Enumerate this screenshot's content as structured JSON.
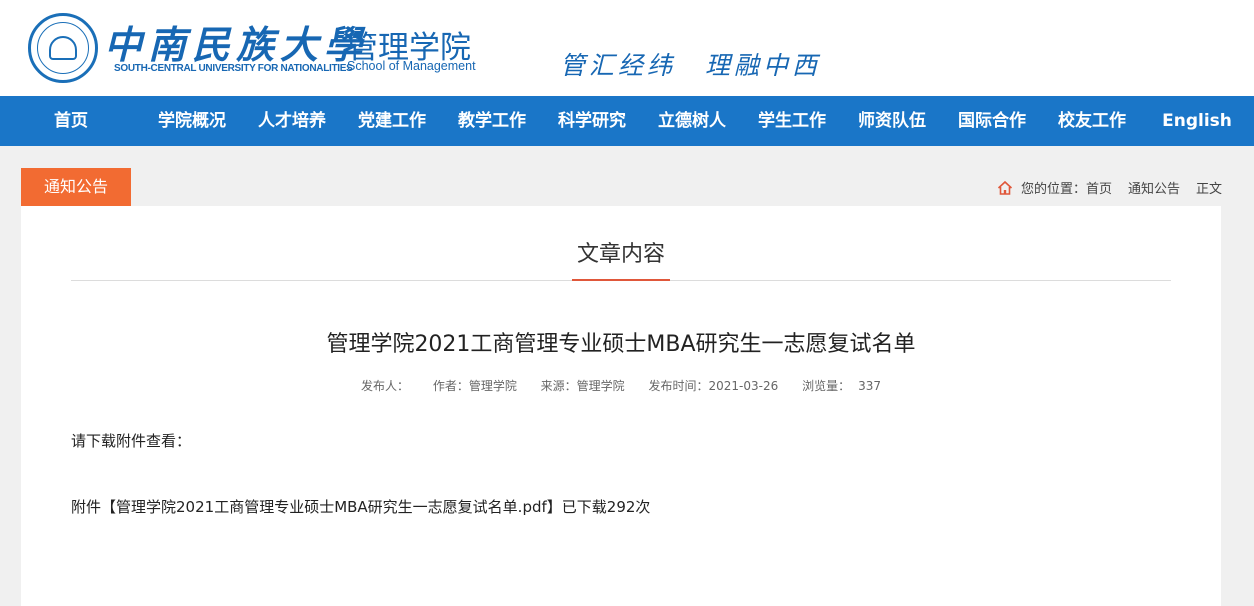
{
  "header": {
    "university_cn": "中南民族大學",
    "university_en": "SOUTH-CENTRAL UNIVERSITY FOR NATIONALITIES",
    "school_cn": "管理学院",
    "school_en": "School of Management",
    "motto": "管汇经纬　理融中西"
  },
  "nav": {
    "items": [
      {
        "label": "首页"
      },
      {
        "label": "学院概况"
      },
      {
        "label": "人才培养"
      },
      {
        "label": "党建工作"
      },
      {
        "label": "教学工作"
      },
      {
        "label": "科学研究"
      },
      {
        "label": "立德树人"
      },
      {
        "label": "学生工作"
      },
      {
        "label": "师资队伍"
      },
      {
        "label": "国际合作"
      },
      {
        "label": "校友工作"
      },
      {
        "label": "English"
      }
    ]
  },
  "section_tab": "通知公告",
  "breadcrumb": {
    "prefix": "您的位置：",
    "items": [
      "首页",
      "通知公告",
      "正文"
    ]
  },
  "content": {
    "section_title": "文章内容",
    "article_title": "管理学院2021工商管理专业硕士MBA研究生一志愿复试名单",
    "meta": {
      "publisher": "发布人：",
      "author": "作者：管理学院",
      "source": "来源：管理学院",
      "date": "发布时间：2021-03-26",
      "views_label": "浏览量：",
      "views": "337"
    },
    "paragraph1": "请下载附件查看：",
    "attachment_prefix": "附件【",
    "attachment_name": "管理学院2021工商管理专业硕士MBA研究生一志愿复试名单.pdf",
    "attachment_suffix": "】已下载292次"
  },
  "colors": {
    "nav_bg": "#1a76c8",
    "brand_blue": "#1767b3",
    "tab_orange": "#f26b32",
    "accent_red": "#e0573a"
  }
}
